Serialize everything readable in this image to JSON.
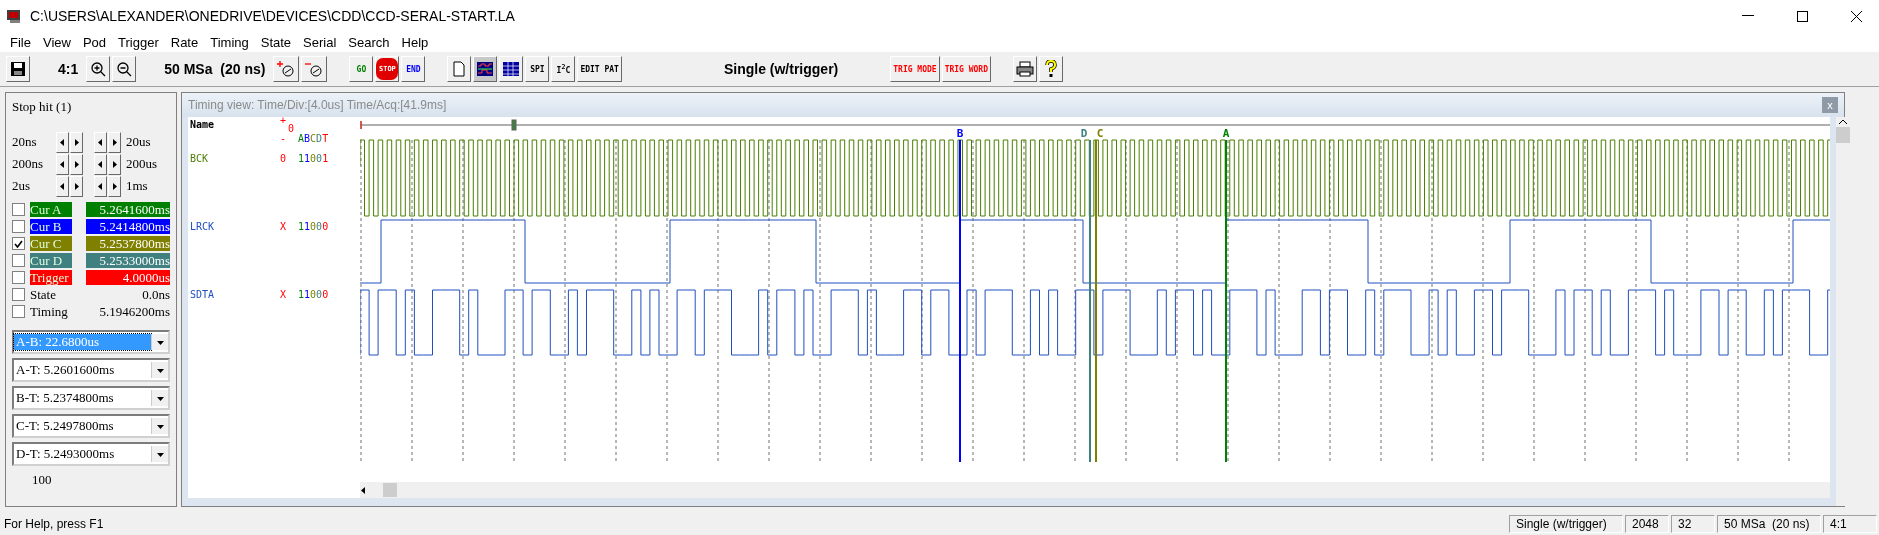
{
  "window": {
    "title": "C:\\USERS\\ALEXANDER\\ONEDRIVE\\DEVICES\\CDD\\CCD-SERAL-START.LA"
  },
  "menu": [
    "File",
    "View",
    "Pod",
    "Trigger",
    "Rate",
    "Timing",
    "State",
    "Serial",
    "Search",
    "Help"
  ],
  "toolbar": [
    [
      {
        "kind": "save"
      }
    ],
    [
      {
        "kind": "text",
        "label": "4:1"
      },
      {
        "kind": "zoom-in"
      },
      {
        "kind": "zoom-out"
      }
    ],
    [
      {
        "kind": "text",
        "label": "50 MSa  (20 ns)"
      },
      {
        "kind": "cursor-add"
      },
      {
        "kind": "cursor-remove"
      }
    ],
    [
      {
        "kind": "label-button",
        "label": "GO",
        "color": "#008000"
      },
      {
        "kind": "stop",
        "label": "STOP"
      },
      {
        "kind": "label-button",
        "label": "END",
        "color": "#0000ff"
      }
    ],
    [
      {
        "kind": "page"
      },
      {
        "kind": "timing",
        "selected": true
      },
      {
        "kind": "list",
        "selected": false
      },
      {
        "kind": "label-button",
        "label": "SPI",
        "color": "#000000"
      },
      {
        "kind": "label-button",
        "label": "I$^{2}$C",
        "color": "#000000"
      },
      {
        "kind": "label-button",
        "label": "EDIT PAT",
        "color": "#000000"
      }
    ],
    [
      {
        "kind": "mode",
        "label": "Single (w/trigger)"
      }
    ],
    [
      {
        "kind": "label-button",
        "label": "TRIG MODE",
        "color": "#ff0000"
      },
      {
        "kind": "label-button",
        "label": "TRIG WORD",
        "color": "#ff0000"
      }
    ],
    [
      {
        "kind": "print"
      },
      {
        "kind": "help"
      }
    ]
  ],
  "left_panel": {
    "status": "Stop hit (1)",
    "steps": [
      {
        "left": "20ns",
        "right": "20us"
      },
      {
        "left": "200ns",
        "right": "200us"
      },
      {
        "left": "2us",
        "right": "1ms"
      }
    ],
    "cursors": [
      {
        "kind": "cursor",
        "label": "Cur A",
        "value": "5.2641600ms",
        "checked": false,
        "color": "#008000"
      },
      {
        "kind": "cursor",
        "label": "Cur B",
        "value": "5.2414800ms",
        "checked": false,
        "color": "#0000ff"
      },
      {
        "kind": "cursor",
        "label": "Cur C",
        "value": "5.2537800ms",
        "checked": true,
        "color": "#808000"
      },
      {
        "kind": "cursor",
        "label": "Cur D",
        "value": "5.2533000ms",
        "checked": false,
        "color": "#408080"
      },
      {
        "kind": "cursor",
        "label": "Trigger",
        "value": "4.0000us",
        "checked": false,
        "color": "#ff0000"
      },
      {
        "kind": "plain",
        "label": "State",
        "value": "0.0ns",
        "checked": false
      },
      {
        "kind": "plain",
        "label": "Timing",
        "value": "5.1946200ms",
        "checked": false
      }
    ],
    "deltas": [
      {
        "value": "A-B: 22.6800us",
        "selected": true
      },
      {
        "value": "A-T: 5.2601600ms",
        "selected": false
      },
      {
        "value": "B-T: 5.2374800ms",
        "selected": false
      },
      {
        "value": "C-T: 5.2497800ms",
        "selected": false
      },
      {
        "value": "D-T: 5.2493000ms",
        "selected": false
      }
    ],
    "count": "100"
  },
  "timing_view": {
    "title": "Timing view:  Time/Div:[4.0us] Time/Acq:[41.9ms]",
    "close": "x",
    "name_header": "Name",
    "plus": "+",
    "zero": "0",
    "minus": "-",
    "columns": "ABCDT",
    "channels": [
      {
        "name": "BCK",
        "state": "0",
        "bits": "11001",
        "color": "#4a7f00",
        "kind": "clock"
      },
      {
        "name": "LRCK",
        "state": "X",
        "bits": "11000",
        "color": "#2050c0",
        "kind": "frame"
      },
      {
        "name": "SDTA",
        "state": "X",
        "bits": "11000",
        "color": "#2050c0",
        "kind": "data"
      }
    ],
    "cursors": [
      {
        "label": "B",
        "color": "#0000ff"
      },
      {
        "label": "D",
        "color": "#408080"
      },
      {
        "label": "C",
        "color": "#808000"
      },
      {
        "label": "A",
        "color": "#008000"
      }
    ]
  },
  "status_bar": {
    "help": "For Help, press F1",
    "panes": [
      "Single (w/trigger)",
      "2048",
      "32",
      "50 MSa  (20 ns)",
      "4:1"
    ]
  }
}
